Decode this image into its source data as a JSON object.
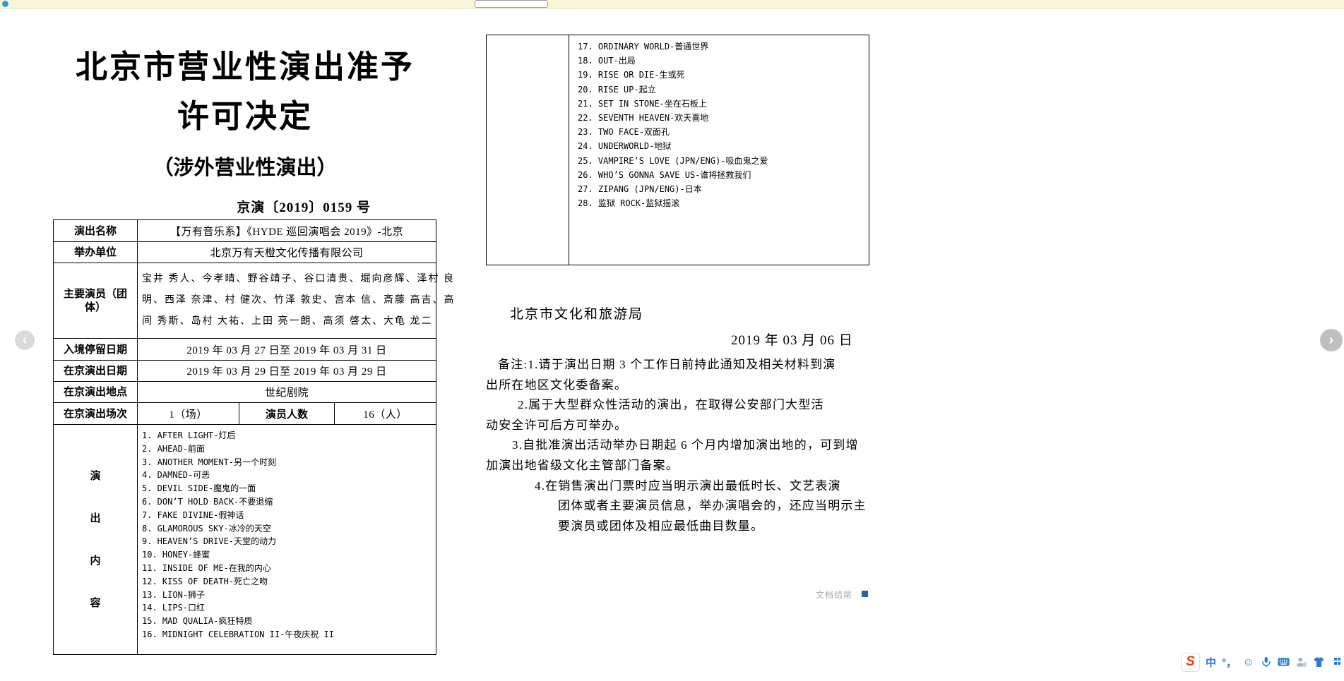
{
  "viewer": {
    "top_bar": {
      "search_value": ""
    },
    "pager": {
      "prev_label": "‹",
      "next_label": "›"
    },
    "end_marker": "文档结尾"
  },
  "page1": {
    "title_line1": "北京市营业性演出准予",
    "title_line2": "许可决定",
    "subtitle": "（涉外营业性演出）",
    "doc_number": "京演〔2019〕0159 号",
    "rows": {
      "r1": {
        "label": "演出名称",
        "value": "【万有音乐系】《HYDE 巡回演唱会 2019》-北京"
      },
      "r2": {
        "label": "举办单位",
        "value": "北京万有天橙文化传播有限公司"
      },
      "r3": {
        "label": "主要演员（团体）",
        "line1": "宝井 秀人、今孝晴、野谷靖子、谷口清贵、堀向彦辉、泽村 良",
        "line2": "明、西泽 奈津、村 健次、竹泽 敦史、宫本 信、斎藤 高吉、高",
        "line3": "间 秀斯、岛村 大祐、上田 亮一朗、高须 啓太、大龟 龙二"
      },
      "r4": {
        "label": "入境停留日期",
        "value": "2019 年 03 月 27 日至 2019 年 03 月 31 日"
      },
      "r5": {
        "label": "在京演出日期",
        "value": "2019 年 03 月 29 日至 2019 年 03 月 29 日"
      },
      "r6": {
        "label": "在京演出地点",
        "value": "世纪剧院"
      },
      "r7": {
        "label": "在京演出场次",
        "value": "1（场）",
        "label2": "演员人数",
        "value2": "16（人）"
      },
      "r8": {
        "c0": "演",
        "c1": "出",
        "c2": "内",
        "c3": "容"
      }
    },
    "songs": [
      "1. AFTER LIGHT-灯后",
      "2. AHEAD-前面",
      "3. ANOTHER MOMENT-另一个时刻",
      "4. DAMNED-可恶",
      "5. DEVIL SIDE-魔鬼的一面",
      "6. DON’T HOLD BACK-不要退缩",
      "7. FAKE DIVINE-假神话",
      "8. GLAMOROUS SKY-冰冷的天空",
      "9. HEAVEN’S DRIVE-天堂的动力",
      "10. HONEY-蜂蜜",
      "11. INSIDE OF ME-在我的内心",
      "12. KISS OF DEATH-死亡之吻",
      "13. LION-狮子",
      "14. LIPS-口红",
      "15. MAD QUALIA-疯狂特质",
      "16. MIDNIGHT CELEBRATION II-午夜庆祝 II"
    ]
  },
  "page2": {
    "songs": [
      "17. ORDINARY WORLD-普通世界",
      "18. OUT-出局",
      "19. RISE OR DIE-生或死",
      "20. RISE UP-起立",
      "21. SET IN STONE-坐在石板上",
      "22. SEVENTH HEAVEN-欢天喜地",
      "23. TWO FACE-双面孔",
      "24. UNDERWORLD-地狱",
      "25. VAMPIRE’S LOVE (JPN/ENG)-吸血鬼之爱",
      "26. WHO’S GONNA SAVE US-谁将拯救我们",
      "27. ZIPANG (JPN/ENG)-日本",
      "28. 监狱 ROCK-监狱摇滚"
    ],
    "authority": "北京市文化和旅游局",
    "date": "2019 年 03 月 06 日",
    "notes": [
      "备注:1.请于演出日期 3 个工作日前持此通知及相关材料到演",
      "出所在地区文化委备案。",
      "2.属于大型群众性活动的演出，在取得公安部门大型活",
      "动安全许可后方可举办。",
      "3.自批准演出活动举办日期起 6 个月内增加演出地的，可到增",
      "加演出地省级文化主管部门备案。",
      "4.在销售演出门票时应当明示演出最低时长、文艺表演",
      "团体或者主要演员信息，举办演唱会的，还应当明示主",
      "要演员或团体及相应最低曲目数量。"
    ]
  },
  "ime": {
    "logo": "S",
    "mode": "中",
    "punct": "°，",
    "emoji": "☺",
    "icon_names": [
      "sogou-logo",
      "chinese-mode",
      "punctuation",
      "emoji",
      "microphone",
      "keyboard",
      "account",
      "skin",
      "more"
    ]
  },
  "colors": {
    "accent_blue": "#2b7bd4",
    "sogou_orange": "#f23c10",
    "end_square_blue": "#2b5fa7",
    "topbar_yellow": "#fbf5d8"
  }
}
